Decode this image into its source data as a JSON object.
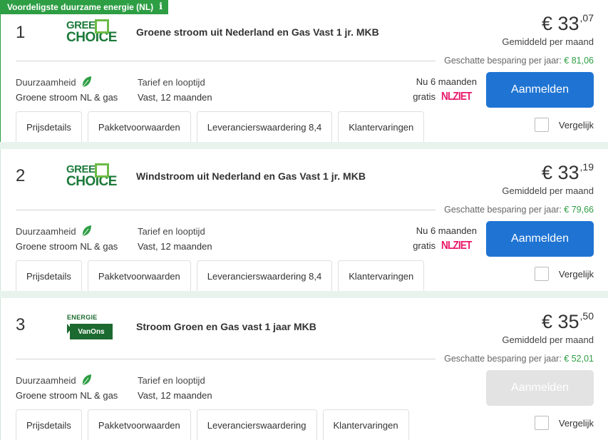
{
  "badge": {
    "label": "Voordeligste duurzame energie (NL)",
    "icon": "info-icon"
  },
  "common": {
    "sustainability_label": "Duurzaamheid",
    "tariff_label": "Tarief en looptijd",
    "per_month": "Gemiddeld per maand",
    "saving_label": "Geschatte besparing per jaar:",
    "compare_label": "Vergelijk",
    "signup_label": "Aanmelden"
  },
  "offers": [
    {
      "rank": "1",
      "logo": "GREEN CHOICE",
      "logo_l1": "GREEN",
      "logo_l2": "CHOICE",
      "title": "Groene stroom uit Nederland en Gas Vast 1 jr. MKB",
      "price_main": "€ 33",
      "price_cents": ",07",
      "saving_amount": "€ 81,06",
      "sustainability_value": "Groene stroom NL & gas",
      "tariff_value": "Vast, 12 maanden",
      "promo_line1": "Nu 6 maanden",
      "promo_line2": "gratis",
      "promo_brand": "NLZIET",
      "signup_enabled": true,
      "tabs": [
        "Prijsdetails",
        "Pakketvoorwaarden",
        "Leverancierswaardering 8,4",
        "Klantervaringen"
      ]
    },
    {
      "rank": "2",
      "logo": "GREEN CHOICE",
      "logo_l1": "GREEN",
      "logo_l2": "CHOICE",
      "title": "Windstroom uit Nederland en Gas Vast 1 jr. MKB",
      "price_main": "€ 33",
      "price_cents": ",19",
      "saving_amount": "€ 79,66",
      "sustainability_value": "Groene stroom NL & gas",
      "tariff_value": "Vast, 12 maanden",
      "promo_line1": "Nu 6 maanden",
      "promo_line2": "gratis",
      "promo_brand": "NLZIET",
      "signup_enabled": true,
      "tabs": [
        "Prijsdetails",
        "Pakketvoorwaarden",
        "Leverancierswaardering 8,4",
        "Klantervaringen"
      ]
    },
    {
      "rank": "3",
      "logo": "ENERGIE VanOns",
      "logo_l1": "ENERGIE",
      "logo_l2": "VanOns",
      "title": "Stroom Groen en Gas vast 1 jaar MKB",
      "price_main": "€ 35",
      "price_cents": ",50",
      "saving_amount": "€ 52,01",
      "sustainability_value": "Groene stroom NL & gas",
      "tariff_value": "Vast, 12 maanden",
      "signup_enabled": false,
      "tabs": [
        "Prijsdetails",
        "Pakketvoorwaarden",
        "Leverancierswaardering",
        "Klantervaringen"
      ]
    }
  ],
  "colors": {
    "green": "#2e9e44",
    "blue_button": "#1f74d3",
    "disabled_button": "#e3e3e3",
    "nlziet": "#e8196b"
  }
}
